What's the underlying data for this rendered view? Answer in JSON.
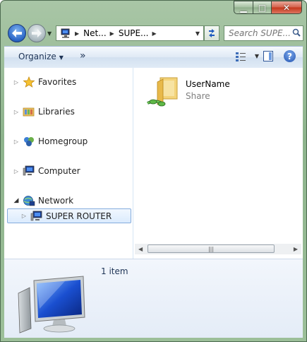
{
  "window": {
    "caption": {
      "minimize": "▁",
      "maximize": "□",
      "close": "✕"
    }
  },
  "nav": {
    "back_icon": "back-arrow-icon",
    "forward_icon": "forward-arrow-icon",
    "breadcrumb": [
      "Net...",
      "SUPE..."
    ],
    "search_placeholder": "Search SUPE..."
  },
  "toolbar": {
    "organize_label": "Organize",
    "more_label": "»",
    "help_label": "?"
  },
  "sidebar": {
    "items": [
      {
        "label": "Favorites",
        "icon": "star-icon"
      },
      {
        "label": "Libraries",
        "icon": "libraries-icon"
      },
      {
        "label": "Homegroup",
        "icon": "homegroup-icon"
      },
      {
        "label": "Computer",
        "icon": "computer-icon"
      },
      {
        "label": "Network",
        "icon": "network-icon"
      },
      {
        "label": "SUPER ROUTER",
        "icon": "computer-icon"
      }
    ]
  },
  "content": {
    "items": [
      {
        "name": "UserName",
        "type": "Share",
        "icon": "shared-folder-icon"
      }
    ],
    "scroll_grip": "|||"
  },
  "details": {
    "count_text": "1 item"
  },
  "colors": {
    "accent": "#2a65c6",
    "selection_border": "#84acdd",
    "frame": "#9cbf99"
  }
}
